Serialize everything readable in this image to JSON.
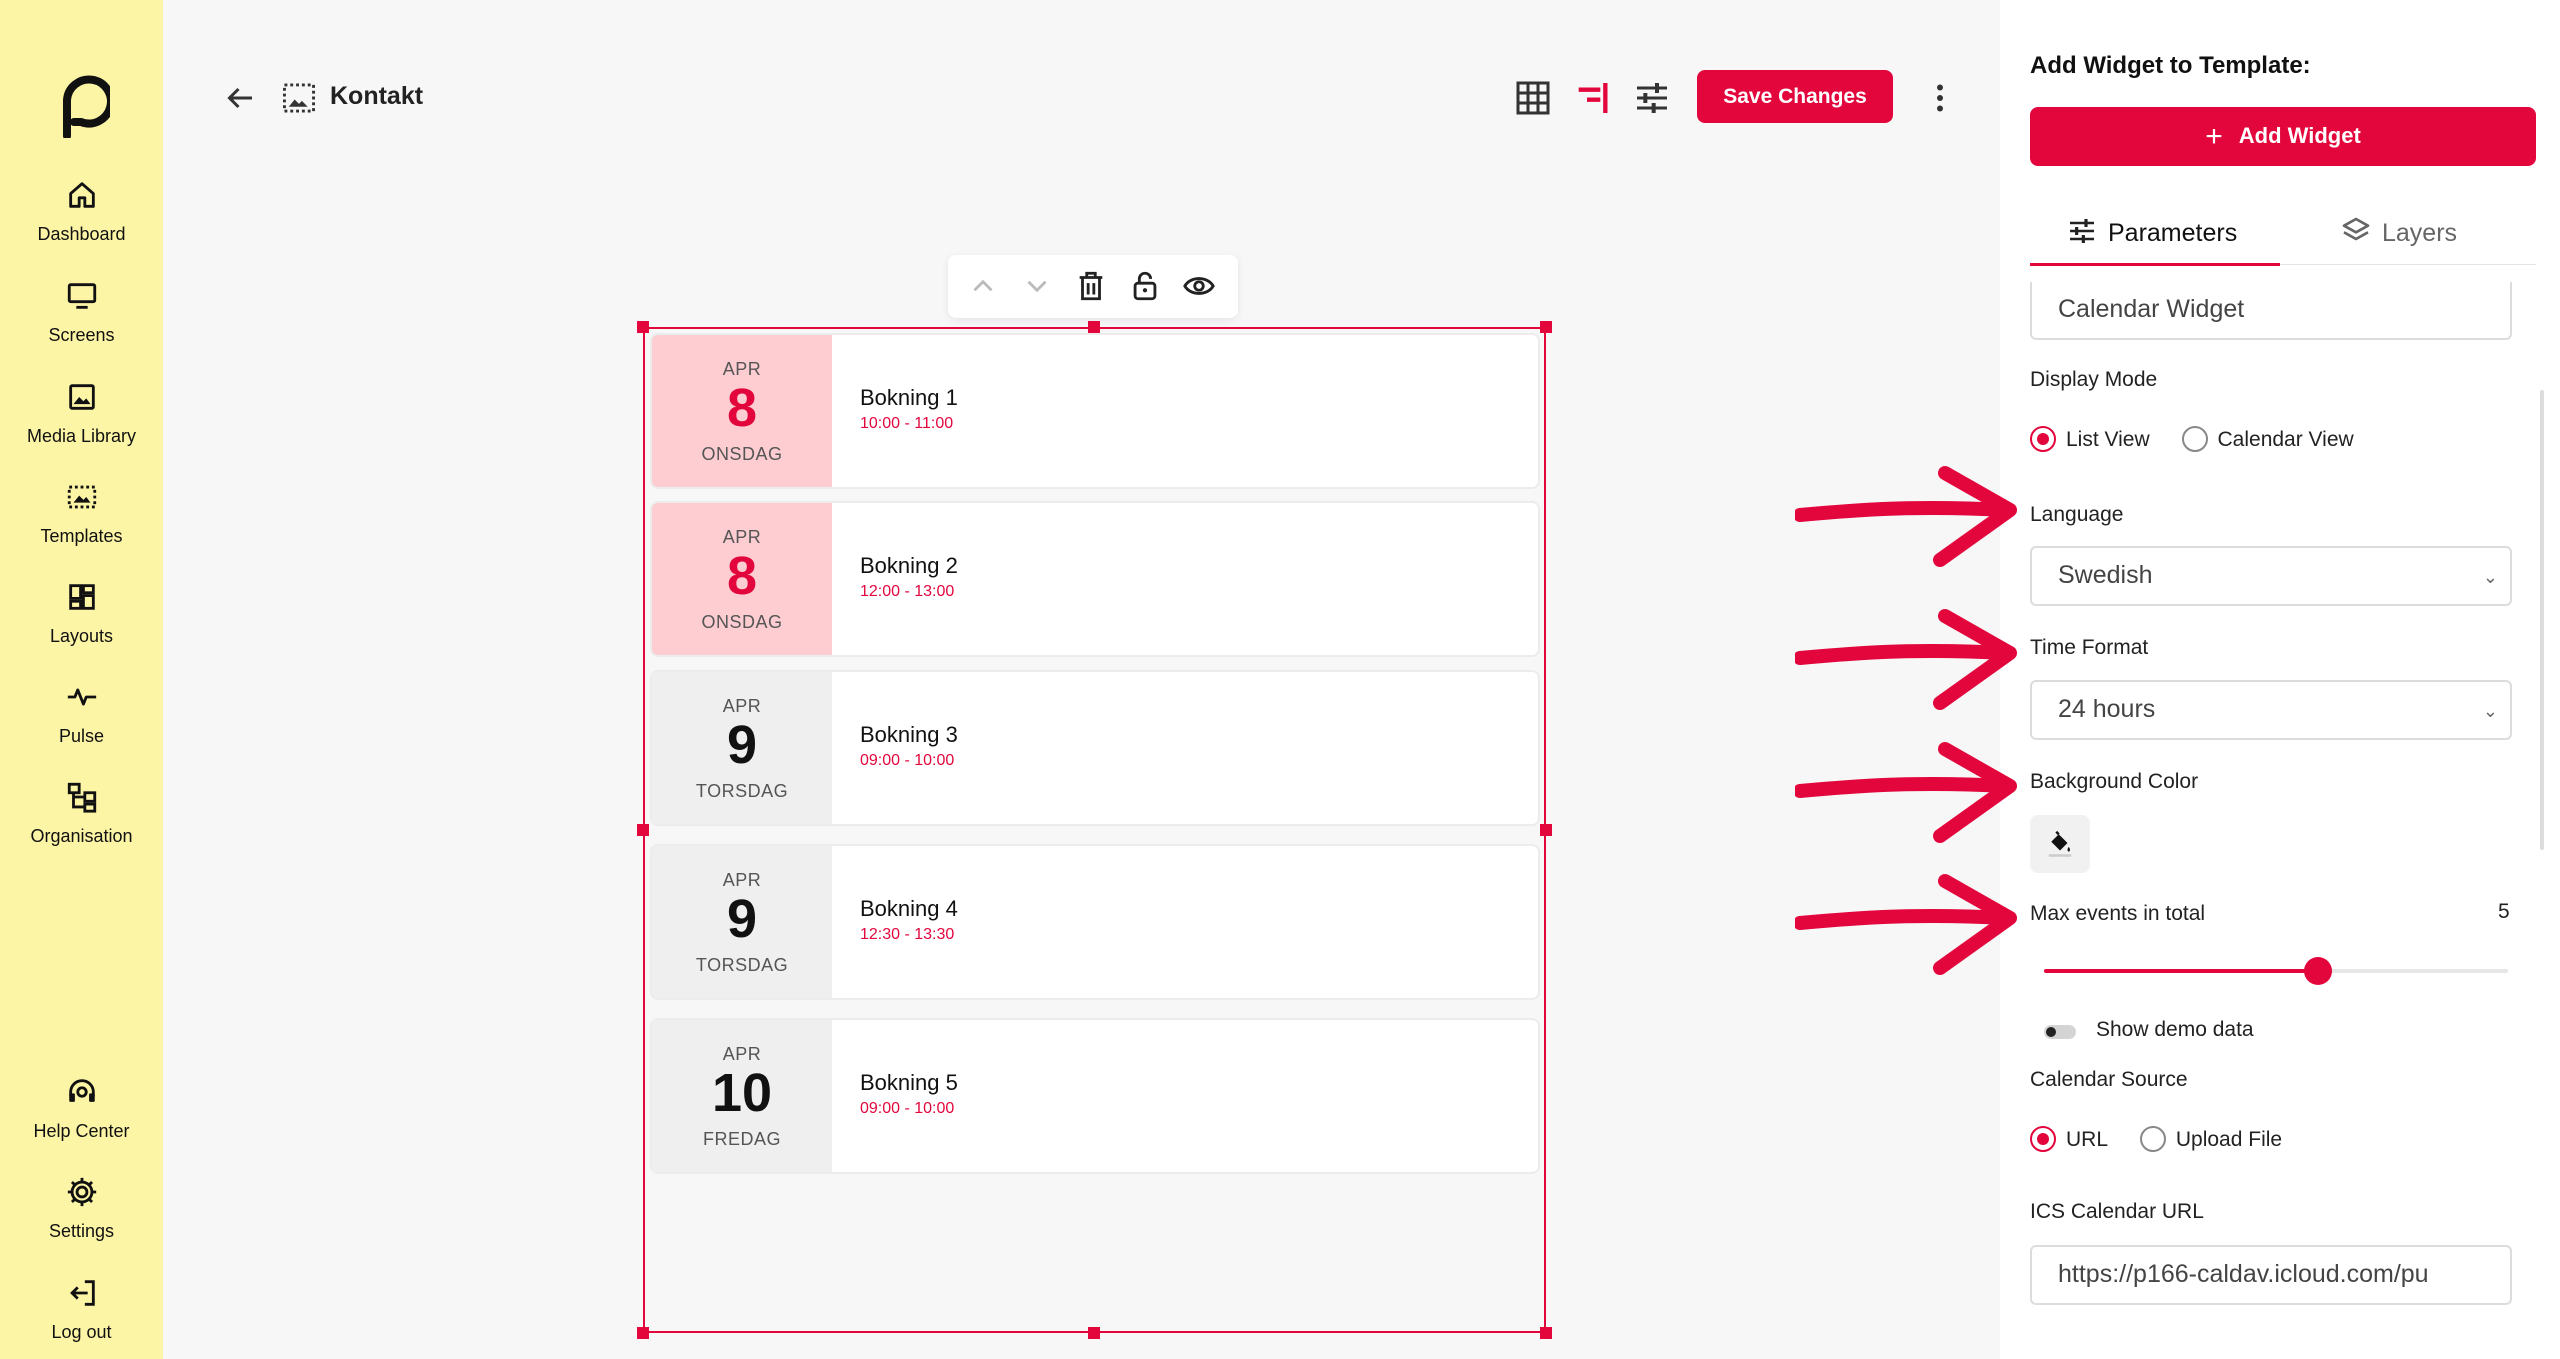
{
  "sidebar": {
    "items": [
      {
        "label": "Dashboard",
        "icon": "home-icon"
      },
      {
        "label": "Screens",
        "icon": "monitor-icon"
      },
      {
        "label": "Media Library",
        "icon": "image-icon"
      },
      {
        "label": "Templates",
        "icon": "template-icon"
      },
      {
        "label": "Layouts",
        "icon": "layouts-icon"
      },
      {
        "label": "Pulse",
        "icon": "pulse-icon"
      },
      {
        "label": "Organisation",
        "icon": "organisation-icon"
      }
    ],
    "bottom_items": [
      {
        "label": "Help Center",
        "icon": "headset-icon"
      },
      {
        "label": "Settings",
        "icon": "gear-icon"
      },
      {
        "label": "Log out",
        "icon": "logout-icon"
      }
    ]
  },
  "header": {
    "title": "Kontakt",
    "save_label": "Save Changes"
  },
  "calendar": {
    "events": [
      {
        "month": "APR",
        "day": "8",
        "weekday": "ONSDAG",
        "title": "Bokning 1",
        "time": "10:00 - 11:00",
        "highlight": true
      },
      {
        "month": "APR",
        "day": "8",
        "weekday": "ONSDAG",
        "title": "Bokning 2",
        "time": "12:00 - 13:00",
        "highlight": true
      },
      {
        "month": "APR",
        "day": "9",
        "weekday": "TORSDAG",
        "title": "Bokning 3",
        "time": "09:00 - 10:00",
        "highlight": false
      },
      {
        "month": "APR",
        "day": "9",
        "weekday": "TORSDAG",
        "title": "Bokning 4",
        "time": "12:30 - 13:30",
        "highlight": false
      },
      {
        "month": "APR",
        "day": "10",
        "weekday": "FREDAG",
        "title": "Bokning 5",
        "time": "09:00 - 10:00",
        "highlight": false
      }
    ]
  },
  "panel": {
    "heading": "Add Widget to Template:",
    "add_widget_label": "Add Widget",
    "tabs": [
      {
        "label": "Parameters",
        "active": true
      },
      {
        "label": "Layers",
        "active": false
      }
    ],
    "widget_name": "Calendar Widget",
    "display_mode": {
      "label": "Display Mode",
      "options": [
        "List View",
        "Calendar View"
      ],
      "selected": "List View"
    },
    "language": {
      "label": "Language",
      "value": "Swedish"
    },
    "time_format": {
      "label": "Time Format",
      "value": "24 hours"
    },
    "background_color": {
      "label": "Background Color"
    },
    "max_events": {
      "label": "Max events in total",
      "value": "5",
      "fraction": 0.59
    },
    "demo": {
      "label": "Show demo data",
      "on": false
    },
    "calendar_source": {
      "label": "Calendar Source",
      "options": [
        "URL",
        "Upload File"
      ],
      "selected": "URL"
    },
    "ics_url": {
      "label": "ICS Calendar URL",
      "value": "https://p166-caldav.icloud.com/pu"
    }
  },
  "colors": {
    "accent": "#e3063d",
    "sidebar_bg": "#fdf5a6",
    "today_bg": "#fdcdd2"
  }
}
